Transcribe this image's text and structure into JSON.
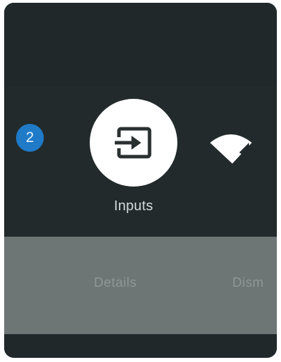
{
  "quick_settings": {
    "notification_badge": "2",
    "inputs": {
      "label": "Inputs",
      "icon": "input-source-icon"
    },
    "network": {
      "icon": "wifi-icon"
    }
  },
  "actions": {
    "details_label": "Details",
    "dismiss_label": "Dism"
  },
  "colors": {
    "background": "#222a2b",
    "badge": "#1f7ac8",
    "action_bar": "#6e7575",
    "button_fill": "#ffffff"
  }
}
